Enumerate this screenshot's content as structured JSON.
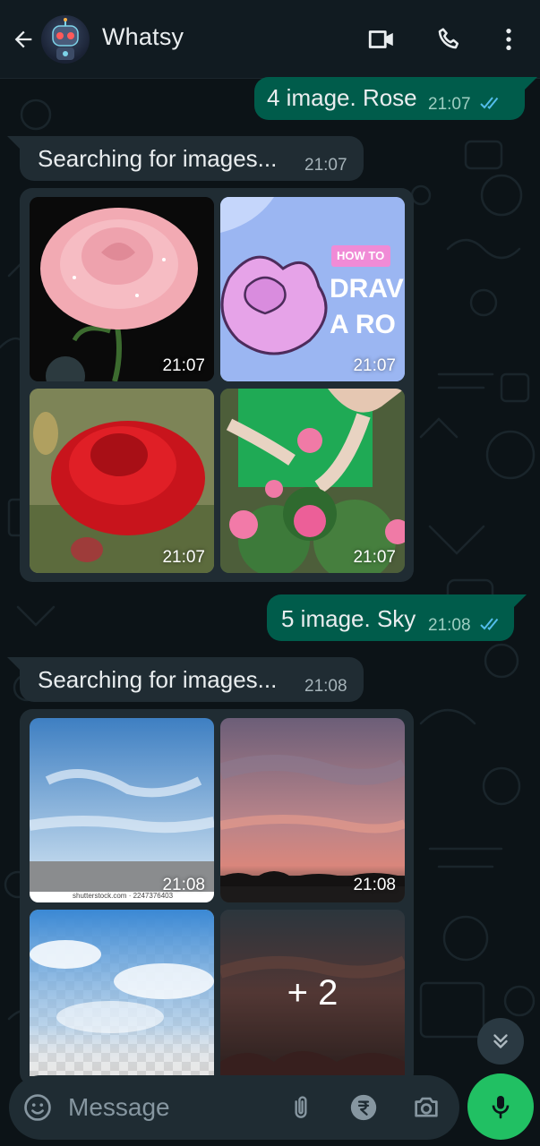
{
  "header": {
    "contact_name": "Whatsy",
    "icons": [
      "back-arrow-icon",
      "video-call-icon",
      "phone-icon",
      "more-vert-icon"
    ]
  },
  "messages": [
    {
      "direction": "out",
      "text": "4 image. Rose",
      "time": "21:07",
      "status": "read"
    },
    {
      "direction": "in",
      "text": "Searching for images...",
      "time": "21:07"
    },
    {
      "direction": "in",
      "type": "image-grid",
      "images": [
        {
          "subject": "pink rose with water droplets",
          "time": "21:07"
        },
        {
          "subject": "how to draw a rose",
          "caption_badge": "HOW TO",
          "caption_lines": [
            "DRAV",
            "A RO"
          ],
          "time": "21:07"
        },
        {
          "subject": "red rose",
          "time": "21:07"
        },
        {
          "subject": "pruning rose bush",
          "time": "21:07"
        }
      ]
    },
    {
      "direction": "out",
      "text": "5 image. Sky",
      "time": "21:08",
      "status": "read"
    },
    {
      "direction": "in",
      "text": "Searching for images...",
      "time": "21:08"
    },
    {
      "direction": "in",
      "type": "image-grid",
      "images": [
        {
          "subject": "blue sky with clouds",
          "watermark": "shutterstock.com · 2247376403",
          "time": "21:08"
        },
        {
          "subject": "pink sunset sky",
          "time": "21:08"
        },
        {
          "subject": "clouds on transparent background",
          "time": ""
        },
        {
          "subject": "dark sunset clouds",
          "more_count": "+ 2",
          "time": ""
        }
      ]
    }
  ],
  "composer": {
    "placeholder": "Message",
    "icons": [
      "emoji-icon",
      "attach-icon",
      "rupee-payment-icon",
      "camera-icon",
      "mic-icon"
    ]
  },
  "colors": {
    "app_bar": "#111b21",
    "chat_bg": "#0c1317",
    "outgoing_bubble": "#005c4b",
    "incoming_bubble": "#202c33",
    "read_ticks": "#53bdeb",
    "mic_button": "#21c063"
  }
}
